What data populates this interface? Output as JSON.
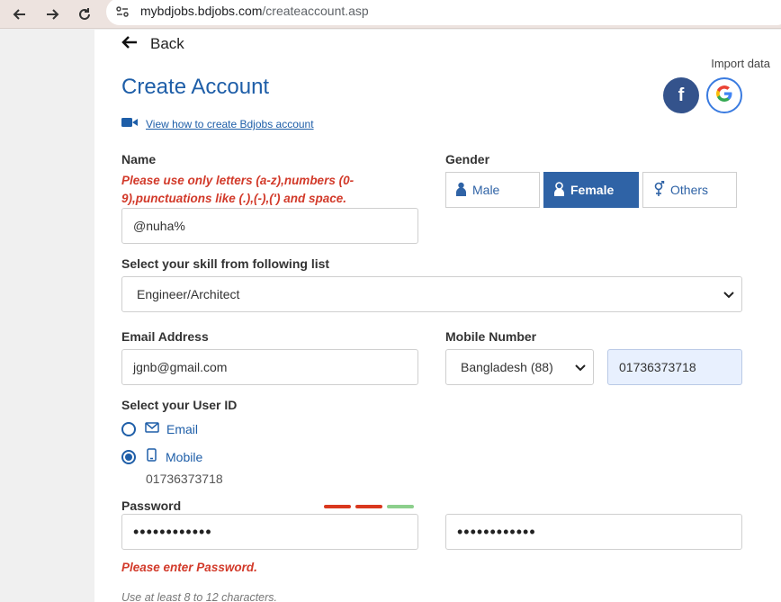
{
  "browser": {
    "url_host": "mybdjobs.bdjobs.com",
    "url_path": "/createaccount.asp"
  },
  "page": {
    "back_label": "Back",
    "import_label": "Import data",
    "title": "Create Account",
    "video_link": "View how to create Bdjobs account"
  },
  "form": {
    "name_label": "Name",
    "name_error": "Please use only letters (a-z),numbers (0-9),punctuations like (.),(-),(') and space.",
    "name_value": "@nuha%",
    "gender_label": "Gender",
    "gender_options": [
      "Male",
      "Female",
      "Others"
    ],
    "gender_selected": "Female",
    "skill_label": "Select your skill from following list",
    "skill_value": "Engineer/Architect",
    "email_label": "Email Address",
    "email_value": "jgnb@gmail.com",
    "mobile_label": "Mobile Number",
    "country_value": "Bangladesh (88)",
    "mobile_value": "01736373718",
    "userid_label": "Select your User ID",
    "userid_options": [
      "Email",
      "Mobile"
    ],
    "userid_selected": "Mobile",
    "userid_mobile_value": "01736373718",
    "password_label": "Password",
    "password_value": "••••••••••••",
    "confirm_password_value": "••••••••••••",
    "password_error": "Please enter Password.",
    "password_hint": "Use at least 8 to 12 characters.",
    "strength_colors": [
      "#d9381e",
      "#d9381e",
      "#8ccf8c"
    ]
  },
  "colors": {
    "brand_blue": "#1e5ea8",
    "error_red": "#d23a2a",
    "facebook": "#34538c"
  },
  "icons": [
    "back-arrow-icon",
    "forward-arrow-icon",
    "reload-icon",
    "site-settings-icon",
    "left-arrow-icon",
    "facebook-icon",
    "google-icon",
    "video-camera-icon",
    "male-icon",
    "female-icon",
    "gender-others-icon",
    "envelope-icon",
    "mobile-phone-icon",
    "chevron-down-icon"
  ]
}
